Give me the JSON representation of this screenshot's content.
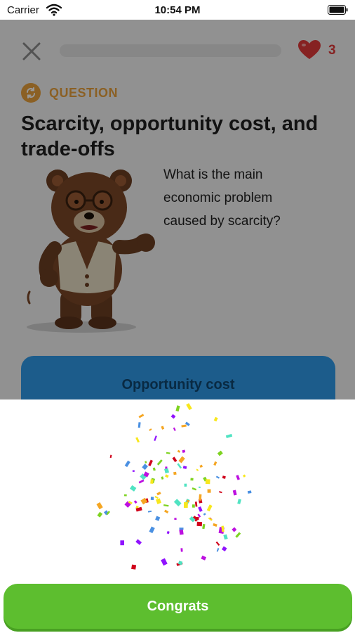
{
  "status_bar": {
    "carrier": "Carrier",
    "time": "10:54 PM"
  },
  "header": {
    "hearts_count": "3"
  },
  "question": {
    "label": "QUESTION",
    "title": "Scarcity, opportunity cost, and trade-offs",
    "text": "What is the main economic problem caused by scarcity?"
  },
  "answer": {
    "label": "Opportunity cost"
  },
  "result": {
    "button_label": "Congrats"
  },
  "colors": {
    "accent_orange": "#e8a03c",
    "heart_red": "#e03a3a",
    "answer_blue": "#2f9ae8",
    "congrats_green": "#5dbe2f"
  },
  "icons": [
    "wifi-icon",
    "battery-icon",
    "close-icon",
    "heart-icon",
    "question-badge-icon",
    "bear-illustration",
    "confetti"
  ]
}
